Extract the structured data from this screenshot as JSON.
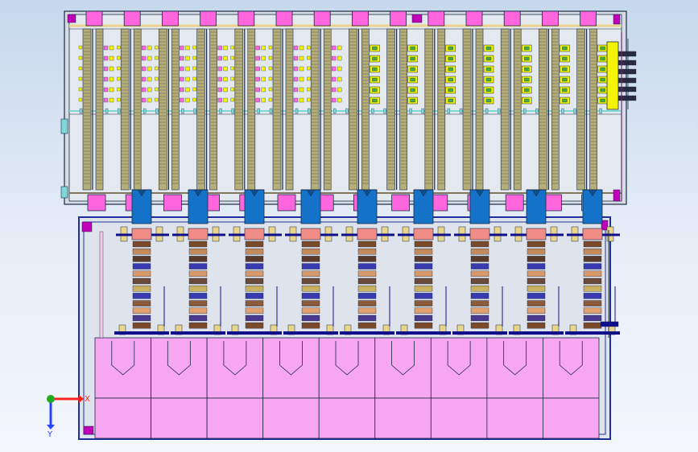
{
  "viewport": {
    "background_top": "#c6d8ec",
    "background_bottom": "#f4f7fc"
  },
  "model": {
    "upper_modules": 14,
    "lower_units": 9,
    "colors": {
      "outline": "#1a2a44",
      "frame_blue": "#1f2e9a",
      "magenta": "#ff66dd",
      "magenta_dark": "#c000b8",
      "pink_block": "#f7a6f2",
      "yellow": "#f4f400",
      "olive": "#807860",
      "olive_light": "#b6ae78",
      "cyan": "#7fd7d7",
      "blue_connector": "#1473c8",
      "salmon": "#f08d86",
      "tan": "#e8d48a",
      "navy": "#10108a"
    }
  },
  "triad": {
    "x_label": "X",
    "y_label": "Y",
    "x_color": "#ff2222",
    "y_color": "#2244ff",
    "origin_color": "#22aa22"
  }
}
